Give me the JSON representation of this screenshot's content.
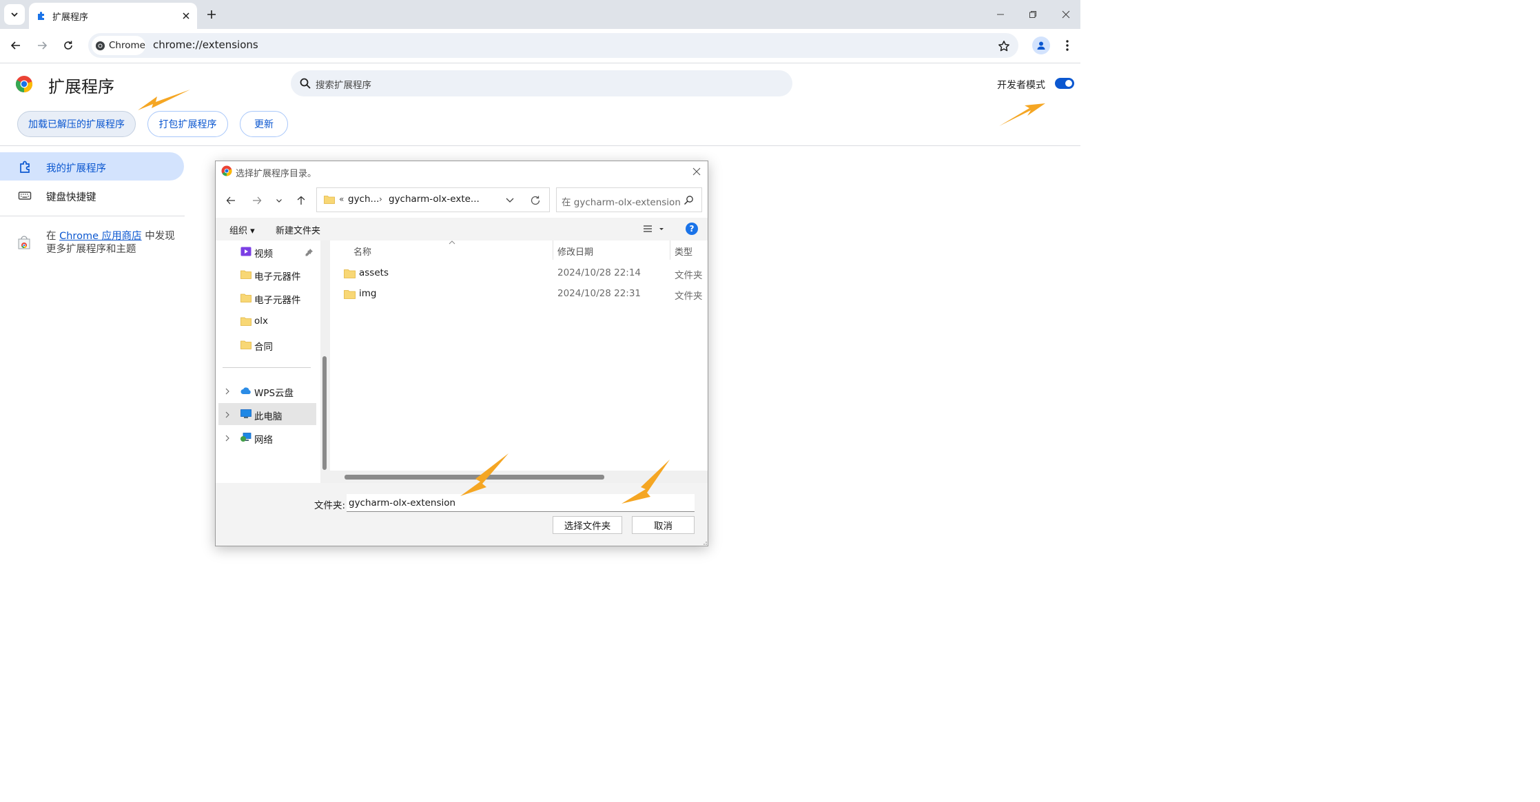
{
  "tab": {
    "title": "扩展程序"
  },
  "omnibox": {
    "chip_label": "Chrome",
    "url": "chrome://extensions"
  },
  "page": {
    "title": "扩展程序",
    "search_placeholder": "搜索扩展程序",
    "dev_mode_label": "开发者模式",
    "dev_mode_on": true,
    "buttons": {
      "load_unpacked": "加载已解压的扩展程序",
      "pack": "打包扩展程序",
      "update": "更新"
    }
  },
  "sidebar": {
    "items": [
      {
        "label": "我的扩展程序"
      },
      {
        "label": "键盘快捷键"
      }
    ],
    "store_prefix": "在",
    "store_link": "Chrome 应用商店",
    "store_suffix": "中发现",
    "store_line2": "更多扩展程序和主题"
  },
  "dialog": {
    "title": "选择扩展程序目录。",
    "breadcrumb": [
      "gych...",
      "gycharm-olx-exte..."
    ],
    "breadcrumb_overflow": "«",
    "breadcrumb_sep": "›",
    "search_placeholder": "在 gycharm-olx-extension...",
    "commands": {
      "organize": "组织 ▾",
      "new_folder": "新建文件夹"
    },
    "tree": {
      "quick": [
        "视频",
        "电子元器件",
        "电子元器件",
        "olx",
        "合同"
      ],
      "roots": [
        "WPS云盘",
        "此电脑",
        "网络"
      ]
    },
    "columns": {
      "name": "名称",
      "date": "修改日期",
      "type": "类型"
    },
    "files": [
      {
        "name": "assets",
        "date": "2024/10/28 22:14",
        "type": "文件夹"
      },
      {
        "name": "img",
        "date": "2024/10/28 22:31",
        "type": "文件夹"
      }
    ],
    "folder_label": "文件夹:",
    "folder_value": "gycharm-olx-extension",
    "select_button": "选择文件夹",
    "cancel_button": "取消"
  },
  "colors": {
    "accent": "#0b57d0",
    "annotation_arrow": "#f5a623"
  }
}
